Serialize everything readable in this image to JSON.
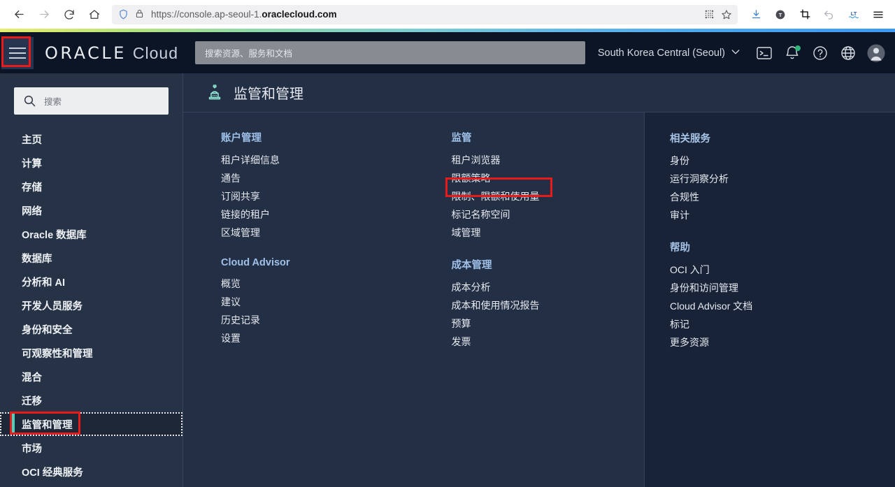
{
  "browser": {
    "url_prefix": "https://console.ap-seoul-1.",
    "url_domain": "oraclecloud.com",
    "back_icon": "back-arrow-icon",
    "forward_icon": "forward-arrow-icon",
    "reload_icon": "reload-icon",
    "home_icon": "home-icon",
    "shield_icon": "shield-icon",
    "lock_icon": "lock-icon",
    "qr_icon": "qr-code-icon",
    "star_icon": "bookmark-star-icon",
    "download_icon": "download-icon",
    "tracker_icon": "tracking-protection-icon",
    "crop_icon": "crop-screenshot-icon",
    "undo_icon": "undo-icon",
    "translate_icon": "languagetool-icon",
    "menu_icon": "browser-menu-icon"
  },
  "header": {
    "hamburger_icon": "hamburger-menu-icon",
    "logo_oracle": "ORACLE",
    "logo_cloud": "Cloud",
    "search_placeholder": "搜索资源、服务和文档",
    "region": "South Korea Central (Seoul)",
    "region_chevron": "chevron-down-icon",
    "cloud_shell_icon": "cloud-shell-icon",
    "notifications_icon": "bell-icon",
    "help_icon": "help-question-icon",
    "language_icon": "globe-icon",
    "profile_icon": "user-avatar-icon"
  },
  "sidebar": {
    "search_placeholder": "搜索",
    "search_icon": "search-icon",
    "items": [
      {
        "label": "主页",
        "active": false
      },
      {
        "label": "计算",
        "active": false
      },
      {
        "label": "存储",
        "active": false
      },
      {
        "label": "网络",
        "active": false
      },
      {
        "label": "Oracle 数据库",
        "active": false
      },
      {
        "label": "数据库",
        "active": false
      },
      {
        "label": "分析和 AI",
        "active": false
      },
      {
        "label": "开发人员服务",
        "active": false
      },
      {
        "label": "身份和安全",
        "active": false
      },
      {
        "label": "可观察性和管理",
        "active": false
      },
      {
        "label": "混合",
        "active": false
      },
      {
        "label": "迁移",
        "active": false
      },
      {
        "label": "监管和管理",
        "active": true
      },
      {
        "label": "市场",
        "active": false
      },
      {
        "label": "OCI 经典服务",
        "active": false
      }
    ]
  },
  "page": {
    "title": "监管和管理",
    "title_icon": "governance-stamp-icon"
  },
  "menu": {
    "left_columns": [
      {
        "groups": [
          {
            "title": "账户管理",
            "links": [
              "租户详细信息",
              "通告",
              "订阅共享",
              "链接的租户",
              "区域管理"
            ]
          },
          {
            "title": "Cloud Advisor",
            "links": [
              "概览",
              "建议",
              "历史记录",
              "设置"
            ]
          }
        ]
      },
      {
        "groups": [
          {
            "title": "监管",
            "links": [
              "租户浏览器",
              "限额策略",
              "限制、限额和使用量",
              "标记名称空间",
              "域管理"
            ]
          },
          {
            "title": "成本管理",
            "links": [
              "成本分析",
              "成本和使用情况报告",
              "预算",
              "发票"
            ]
          }
        ]
      }
    ],
    "right_column": {
      "groups": [
        {
          "title": "相关服务",
          "links": [
            "身份",
            "运行洞察分析",
            "合规性",
            "审计"
          ]
        },
        {
          "title": "帮助",
          "links": [
            "OCI 入门",
            "身份和访问管理",
            "Cloud Advisor 文档",
            "标记",
            "更多资源"
          ]
        }
      ]
    }
  },
  "annotations": {
    "highlight_color": "#e81b1b",
    "boxes": [
      "hamburger-menu-icon",
      "监管和管理",
      "限制、限额和使用量"
    ]
  },
  "colors": {
    "header_bg": "#0c1526",
    "sidebar_bg": "#263245",
    "main_bg": "#232f44",
    "right_panel_bg": "#182338",
    "group_title": "#9fc0e8",
    "accent_teal": "#4ad2c0",
    "page_icon": "#8fe3d2"
  }
}
